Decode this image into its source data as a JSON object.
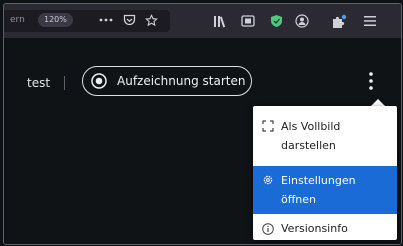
{
  "browser": {
    "url_partial": "ern",
    "zoom": "120%",
    "icons": [
      "more-icon",
      "pocket-icon",
      "star-icon",
      "library-icon",
      "reader-icon",
      "shield-extension-icon",
      "account-icon",
      "extensions-icon",
      "hamburger-menu-icon"
    ]
  },
  "app": {
    "test_label": "test",
    "record_button_label": "Aufzeichnung starten"
  },
  "menu": {
    "items": [
      {
        "label_line1": "Als Vollbild",
        "label_line2": "darstellen",
        "icon": "fullscreen-icon"
      },
      {
        "label_line1": "Einstellungen",
        "label_line2": "öffnen",
        "icon": "gear-icon",
        "selected": true
      },
      {
        "label_line1": "Versionsinfo",
        "label_line2": "",
        "icon": "info-icon"
      }
    ]
  },
  "colors": {
    "toolbar": "#2b2a33",
    "background": "#0f1316",
    "selected": "#1a6bd6",
    "shield": "#4fc77e"
  }
}
